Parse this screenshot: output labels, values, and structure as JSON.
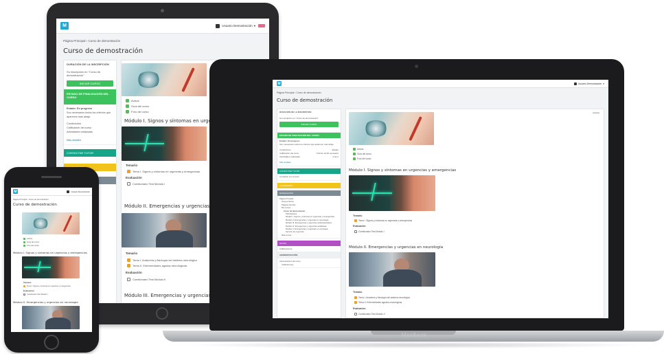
{
  "brand": {
    "logo_text": "M"
  },
  "course": {
    "title": "Curso de demostración",
    "breadcrumb": [
      "Página Principal",
      "Curso de demostración"
    ],
    "user_name": "Usuario Demostración",
    "edit_menu": "Ajustes"
  },
  "sidebar": {
    "progress_title": "DURACIÓN DE LA INSCRIPCIÓN",
    "progress_text": "Su inscripción en \"Curso de demostración\"",
    "progress_button": "INICIAR CURSO",
    "section_header": "ESTADO DE FINALIZACIÓN DEL CURSO",
    "status_label": "Estado: En progreso",
    "status_text": "Son necesarios todos los criterios que aparecen más abajo",
    "rows": [
      {
        "label": "Condiciones",
        "value": "Estado"
      },
      {
        "label": "Calificación del curso",
        "value": "0,00 de 10,00 necesario"
      },
      {
        "label": "Actividades realizadas",
        "value": "0 de 2"
      }
    ],
    "more_details": "Más detalles",
    "contact_header": "CONTACTAR TUTOR",
    "contact_text": "Contactar con el tutor",
    "calendar_header": "CALENDARIO",
    "navigation_header": "NAVEGACIÓN",
    "nav_items": [
      "Página Principal",
      "Área personal",
      "Páginas del sitio",
      "Mis cursos",
      "Curso de demostración",
      "Participantes",
      "Módulo I. Signos y síntomas en urgencias y emergencias",
      "Módulo II. Emergencias y urgencias en neurología",
      "Módulo III. Emergencias y urgencias cardiovasculares",
      "Módulo IV. Emergencias y urgencias pediátricas",
      "Módulo V. Emergencias y urgencias en oncología",
      "Servicio de urgencias",
      "Más cursos"
    ],
    "notes_header": "NOTAS",
    "notes_item": "Calificaciones",
    "admin_header": "ADMINISTRACIÓN",
    "admin_items": [
      "Administración del curso",
      "Calificaciones"
    ]
  },
  "main": {
    "intro_items": [
      "Avisos",
      "Guía del curso",
      "Foro del curso"
    ],
    "modules": [
      {
        "title": "Módulo I. Signos y síntomas en urgencias y emergencias",
        "temario_label": "Temario",
        "temario_item": "Tema I. Signos y síntomas en urgencias y emergencias",
        "eval_label": "Evaluación",
        "eval_item": "Cuestionario Test Módulo I"
      },
      {
        "title": "Módulo II. Emergencias y urgencias en neurología",
        "temario_label": "Temario",
        "temario_items": [
          "Tema I. Anatomía y fisiología del sistema neurológico",
          "Tema II. Enfermedades agudas neurológicas"
        ],
        "eval_label": "Evaluación",
        "eval_item": "Cuestionario Test Módulo II"
      },
      {
        "title": "Módulo III. Emergencias y urgencias cardiovasculares"
      }
    ]
  },
  "device_label": "MacBook",
  "colors": {
    "accent_blue": "#1fa8d6",
    "green": "#3cc35e",
    "teal": "#17a589",
    "yellow": "#f2c31a",
    "gray": "#7c8a94",
    "purple": "#b24fc4"
  }
}
